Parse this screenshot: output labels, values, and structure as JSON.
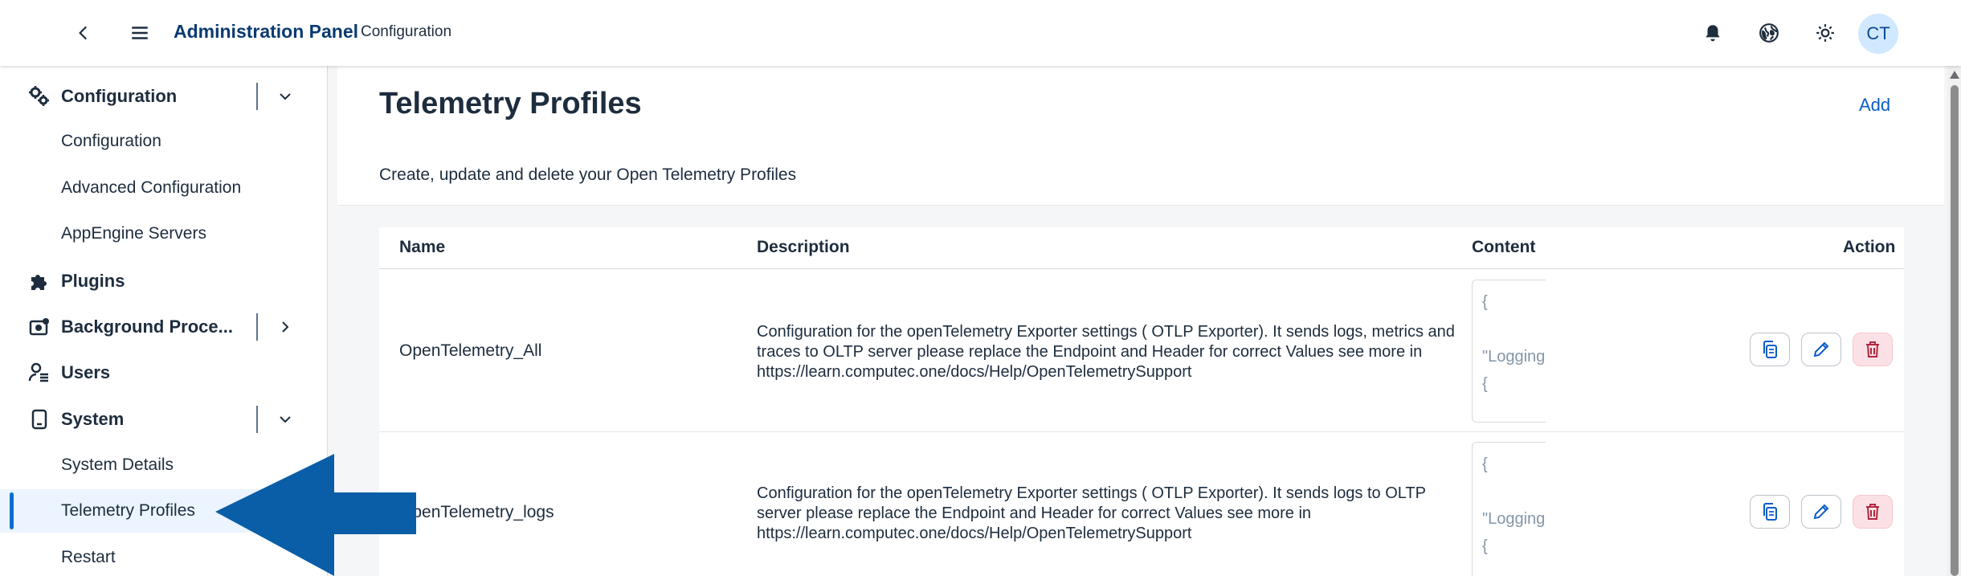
{
  "header": {
    "title": "Administration Panel",
    "subtitle": "Configuration",
    "avatar_initials": "CT"
  },
  "sidebar": {
    "groups": [
      {
        "label": "Configuration",
        "icon": "gears-icon",
        "expanded": true,
        "children": [
          "Configuration",
          "Advanced Configuration",
          "AppEngine Servers"
        ]
      },
      {
        "label": "Plugins",
        "icon": "puzzle-icon"
      },
      {
        "label": "Background Proce...",
        "icon": "process-icon",
        "expanded": false
      },
      {
        "label": "Users",
        "icon": "user-settings-icon"
      },
      {
        "label": "System",
        "icon": "device-icon",
        "expanded": true,
        "children": [
          "System Details",
          "Telemetry Profiles",
          "Restart"
        ]
      }
    ],
    "selected": "Telemetry Profiles"
  },
  "page": {
    "title": "Telemetry Profiles",
    "add_label": "Add",
    "description": "Create, update and delete your Open Telemetry Profiles"
  },
  "table": {
    "columns": [
      "Name",
      "Description",
      "Content",
      "Action"
    ],
    "rows": [
      {
        "name": "OpenTelemetry_All",
        "description": "Configuration for the openTelemetry Exporter settings ( OTLP Exporter). It sends logs, metrics and traces to OLTP server please replace the Endpoint and Header for correct Values see more in https://learn.computec.one/docs/Help/OpenTelemetrySupport",
        "content_lines": [
          "{",
          "",
          "\"Logging",
          "{"
        ]
      },
      {
        "name": "OpenTelemetry_logs",
        "description": "Configuration for the openTelemetry Exporter settings ( OTLP Exporter). It sends logs to OLTP server please replace the Endpoint and Header for correct Values see more in https://learn.computec.one/docs/Help/OpenTelemetrySupport",
        "content_lines": [
          "{",
          "",
          "\"Logging",
          "{"
        ]
      }
    ]
  },
  "colors": {
    "brand": "#0a3a72",
    "link": "#0a5cc7",
    "selected_bg": "#ebf4ff",
    "callout_arrow": "#0a5ea8",
    "delete_bg": "#fbe1e6",
    "delete_icon": "#b3263e"
  }
}
